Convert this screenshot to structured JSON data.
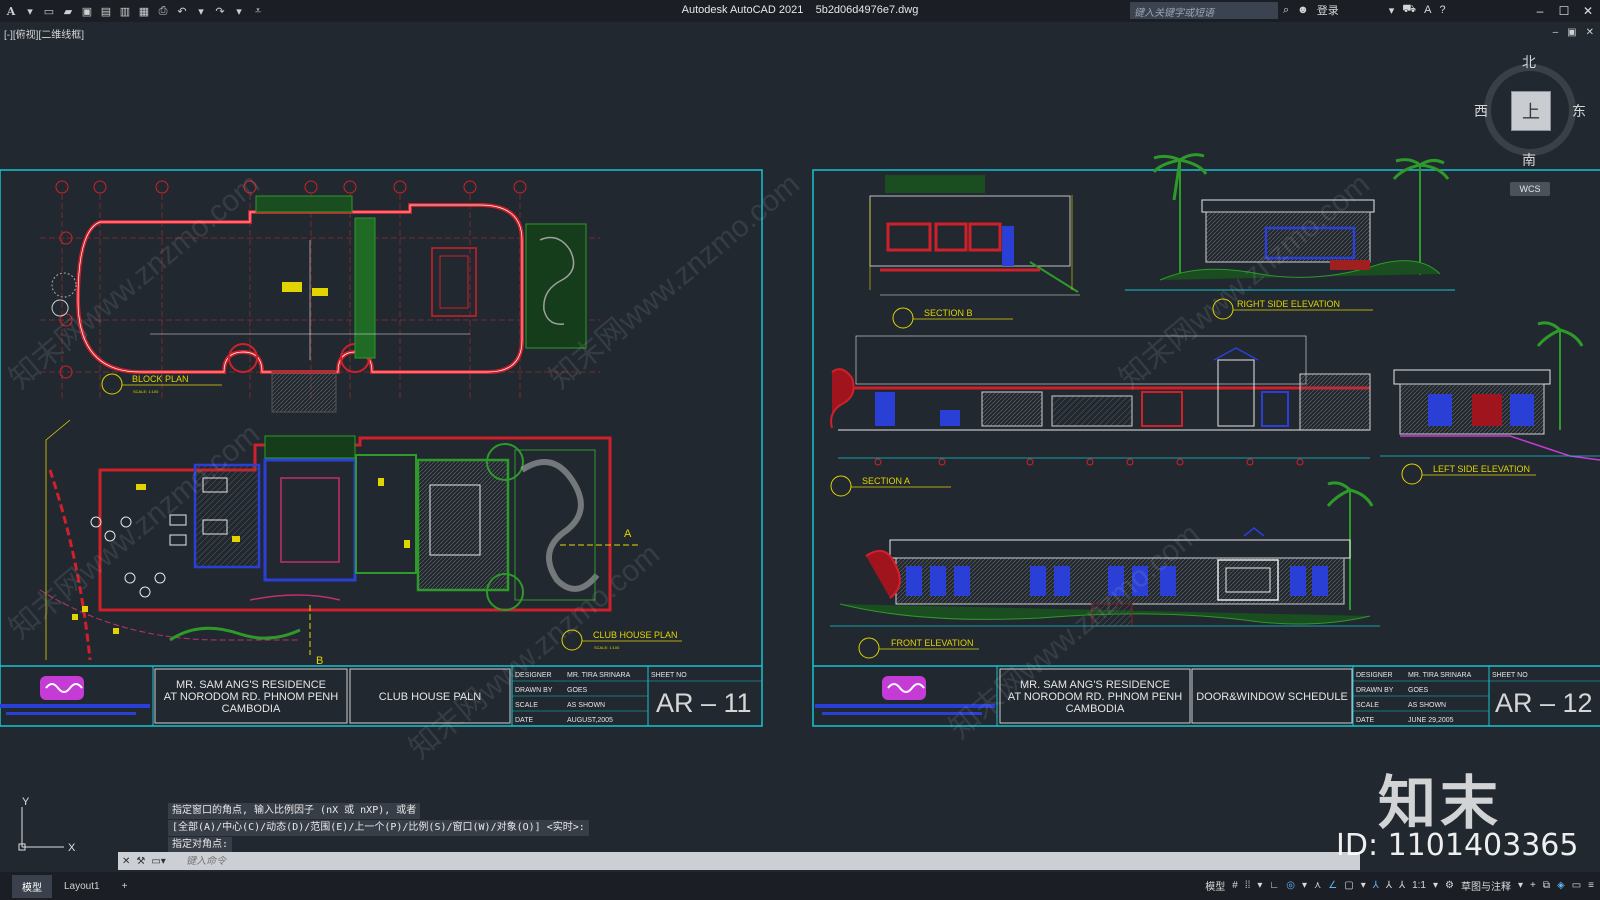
{
  "app": {
    "title": "Autodesk AutoCAD 2021",
    "filename": "5b2d06d4976e7.dwg",
    "search_placeholder": "键入关键字或短语",
    "login_label": "登录"
  },
  "viewport": {
    "label": "[-][俯视][二维线框]"
  },
  "viewcube": {
    "top_face": "上",
    "north": "北",
    "south": "南",
    "west": "西",
    "east": "东",
    "wcs_label": "WCS"
  },
  "sheets": [
    {
      "client_line1": "MR. SAM ANG'S RESIDENCE",
      "client_line2": "AT NORODOM RD. PHNOM PENH",
      "client_line3": "CAMBODIA",
      "drawing_title": "CLUB HOUSE PALN",
      "designer_label": "DESIGNER",
      "designer": "MR. TIRA SRINARA",
      "drawn_label": "DRAWN BY",
      "drawn_by": "GOES",
      "scale_label": "SCALE",
      "scale": "AS SHOWN",
      "date_label": "DATE",
      "date": "AUGUST,2005",
      "sheet_no_label": "SHEET NO",
      "sheet_no": "AR – 11",
      "plan_labels": [
        "BLOCK PLAN",
        "CLUB HOUSE PLAN"
      ],
      "scale_note": "SCALE: 1:100"
    },
    {
      "client_line1": "MR. SAM ANG'S RESIDENCE",
      "client_line2": "AT NORODOM RD. PHNOM PENH",
      "client_line3": "CAMBODIA",
      "drawing_title": "DOOR&WINDOW SCHEDULE",
      "designer_label": "DESIGNER",
      "designer": "MR. TIRA SRINARA",
      "drawn_label": "DRAWN BY",
      "drawn_by": "GOES",
      "scale_label": "SCALE",
      "scale": "AS SHOWN",
      "date_label": "DATE",
      "date": "JUNE 29,2005",
      "sheet_no_label": "SHEET NO",
      "sheet_no": "AR – 12",
      "view_labels": [
        "SECTION B",
        "RIGHT SIDE ELEVATION",
        "SECTION A",
        "LEFT SIDE ELEVATION",
        "FRONT ELEVATION"
      ]
    }
  ],
  "section_markers": [
    "A",
    "B"
  ],
  "command": {
    "history": [
      "指定窗口的角点, 输入比例因子 (nX 或 nXP), 或者",
      "[全部(A)/中心(C)/动态(D)/范围(E)/上一个(P)/比例(S)/窗口(W)/对象(O)] <实时>:",
      "指定对角点:"
    ],
    "placeholder": "键入命令"
  },
  "ucs": {
    "x": "X",
    "y": "Y"
  },
  "status": {
    "tabs": [
      "模型",
      "Layout1"
    ],
    "active_tab": "模型",
    "model_label": "模型",
    "scale": "1:1",
    "workspace": "草图与注释"
  },
  "watermark": {
    "brand": "知末",
    "id": "ID: 1101403365",
    "diagonal": "知末网www.znzmo.com"
  },
  "colors": {
    "background": "#212830",
    "sheet_border": "#19c2cf",
    "wall": "#d0202a",
    "label": "#e2d400",
    "landscape": "#2e9a2a",
    "window": "#2a3fd6"
  }
}
